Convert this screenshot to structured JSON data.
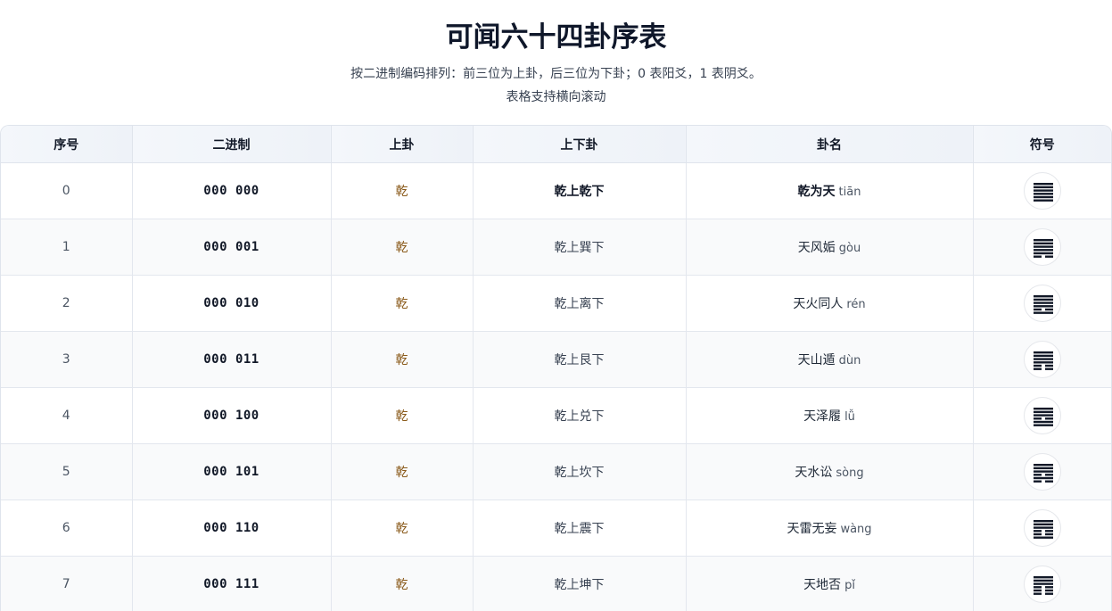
{
  "page": {
    "title": "可闻六十四卦序表",
    "subtitle": "按二进制编码排列：前三位为上卦，后三位为下卦；0 表阳爻，1 表阴爻。",
    "subtitle2": "表格支持横向滚动"
  },
  "table": {
    "headers": [
      "序号",
      "二进制",
      "上卦",
      "上下卦",
      "卦名",
      "符号"
    ],
    "rows": [
      {
        "idx": "0",
        "bin": "000 000",
        "upper": "乾",
        "combo": "乾上乾下",
        "name": "乾为天",
        "pinyin": "tiān",
        "bits": "000000"
      },
      {
        "idx": "1",
        "bin": "000 001",
        "upper": "乾",
        "combo": "乾上巽下",
        "name": "天风姤",
        "pinyin": "gòu",
        "bits": "000001"
      },
      {
        "idx": "2",
        "bin": "000 010",
        "upper": "乾",
        "combo": "乾上离下",
        "name": "天火同人",
        "pinyin": "rén",
        "bits": "000010"
      },
      {
        "idx": "3",
        "bin": "000 011",
        "upper": "乾",
        "combo": "乾上艮下",
        "name": "天山遁",
        "pinyin": "dùn",
        "bits": "000011"
      },
      {
        "idx": "4",
        "bin": "000 100",
        "upper": "乾",
        "combo": "乾上兑下",
        "name": "天泽履",
        "pinyin": "lǚ",
        "bits": "000100"
      },
      {
        "idx": "5",
        "bin": "000 101",
        "upper": "乾",
        "combo": "乾上坎下",
        "name": "天水讼",
        "pinyin": "sòng",
        "bits": "000101"
      },
      {
        "idx": "6",
        "bin": "000 110",
        "upper": "乾",
        "combo": "乾上震下",
        "name": "天雷无妄",
        "pinyin": "wàng",
        "bits": "000110"
      },
      {
        "idx": "7",
        "bin": "000 111",
        "upper": "乾",
        "combo": "乾上坤下",
        "name": "天地否",
        "pinyin": "pǐ",
        "bits": "000111"
      }
    ]
  },
  "colors": {
    "accent_upper": "#8a5a1a",
    "symbol_line": "#111827"
  }
}
